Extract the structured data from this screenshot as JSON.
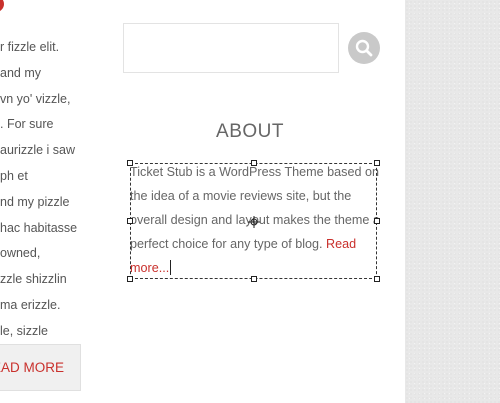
{
  "left_post": {
    "lines": [
      "r fizzle elit.",
      "and my",
      "vn yo' vizzle,",
      ". For sure",
      "aurizzle i saw",
      "ph et",
      "nd my pizzle",
      "hac habitasse",
      "owned,",
      "zzle shizzlin",
      "ma erizzle.",
      "le, sizzle"
    ],
    "read_more_label": "EAD MORE"
  },
  "search": {
    "value": "",
    "placeholder": "",
    "button_icon": "search-icon"
  },
  "about": {
    "heading": "ABOUT",
    "text": "Ticket Stub is a WordPress Theme based on the idea of a movie reviews site, but the overall design and layout makes the theme a perfect choice for any type of blog. ",
    "read_more_link": "Read more..."
  },
  "colors": {
    "accent": "#c9302c",
    "text": "#666666",
    "search_button": "#c9c9c9",
    "sidebar_background": "#e8e8e8"
  }
}
